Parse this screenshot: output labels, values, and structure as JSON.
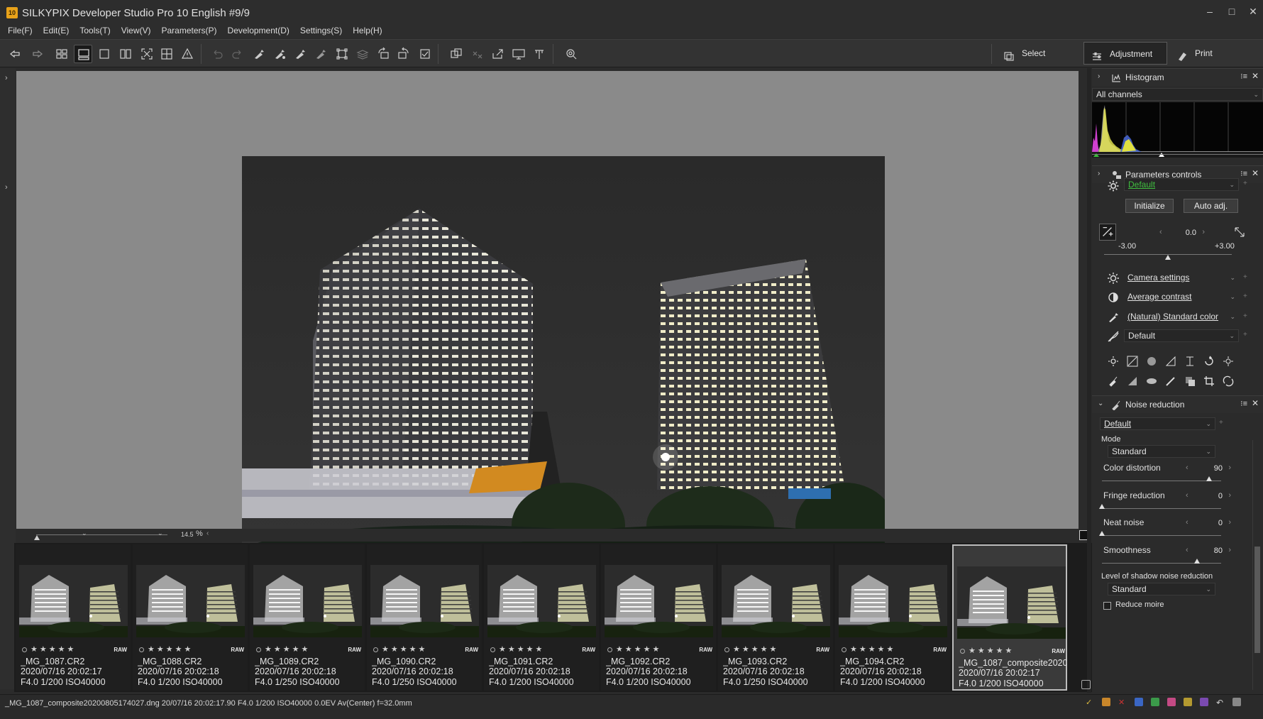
{
  "window": {
    "app_icon_text": "10",
    "title": "SILKYPIX Developer Studio Pro 10 English   #9/9",
    "controls": {
      "minimize": "–",
      "maximize": "□",
      "close": "✕"
    }
  },
  "menubar": {
    "items": [
      "File(F)",
      "Edit(E)",
      "Tools(T)",
      "View(V)",
      "Parameters(P)",
      "Development(D)",
      "Settings(S)",
      "Help(H)"
    ]
  },
  "toolbar": {
    "mode_tabs": [
      {
        "label": "Select",
        "icon": "select-mode-icon"
      },
      {
        "label": "Adjustment",
        "icon": "adjustment-mode-icon",
        "active": true
      },
      {
        "label": "Print",
        "icon": "print-mode-icon"
      }
    ]
  },
  "zoombar": {
    "value": "14.5",
    "unit": "%"
  },
  "thumbnails": [
    {
      "name": "_MG_1087.CR2",
      "datetime": "2020/07/16 20:02:17",
      "exposure": "F4.0 1/200 ISO40000",
      "badge": "RAW",
      "rating": "★★★★★"
    },
    {
      "name": "_MG_1088.CR2",
      "datetime": "2020/07/16 20:02:18",
      "exposure": "F4.0 1/200 ISO40000",
      "badge": "RAW",
      "rating": "★★★★★"
    },
    {
      "name": "_MG_1089.CR2",
      "datetime": "2020/07/16 20:02:18",
      "exposure": "F4.0 1/250 ISO40000",
      "badge": "RAW",
      "rating": "★★★★★"
    },
    {
      "name": "_MG_1090.CR2",
      "datetime": "2020/07/16 20:02:18",
      "exposure": "F4.0 1/250 ISO40000",
      "badge": "RAW",
      "rating": "★★★★★"
    },
    {
      "name": "_MG_1091.CR2",
      "datetime": "2020/07/16 20:02:18",
      "exposure": "F4.0 1/200 ISO40000",
      "badge": "RAW",
      "rating": "★★★★★"
    },
    {
      "name": "_MG_1092.CR2",
      "datetime": "2020/07/16 20:02:18",
      "exposure": "F4.0 1/200 ISO40000",
      "badge": "RAW",
      "rating": "★★★★★"
    },
    {
      "name": "_MG_1093.CR2",
      "datetime": "2020/07/16 20:02:18",
      "exposure": "F4.0 1/250 ISO40000",
      "badge": "RAW",
      "rating": "★★★★★"
    },
    {
      "name": "_MG_1094.CR2",
      "datetime": "2020/07/16 20:02:18",
      "exposure": "F4.0 1/200 ISO40000",
      "badge": "RAW",
      "rating": "★★★★★"
    },
    {
      "name": "_MG_1087_composite2020",
      "datetime": "2020/07/16 20:02:17",
      "exposure": "F4.0 1/200 ISO40000",
      "badge": "RAW",
      "rating": "★★★★★",
      "selected": true
    }
  ],
  "histogram": {
    "title": "Histogram",
    "channel": "All channels"
  },
  "params": {
    "title": "Parameters controls",
    "preset": "Default",
    "initialize": "Initialize",
    "auto_adj": "Auto adj.",
    "exposure": {
      "value": "0.0",
      "min": "-3.00",
      "max": "+3.00",
      "level": 0.5
    },
    "rows": [
      {
        "label": "Camera settings",
        "icon": "white-balance-icon"
      },
      {
        "label": "Average contrast",
        "icon": "contrast-icon"
      },
      {
        "label": "(Natural) Standard color",
        "icon": "color-icon"
      },
      {
        "label": "Default",
        "icon": "tone-curve-icon"
      }
    ]
  },
  "noise": {
    "title": "Noise reduction",
    "preset": "Default",
    "mode_label": "Mode",
    "mode_value": "Standard",
    "params": [
      {
        "label": "Color distortion",
        "value": "90",
        "level": 0.9
      },
      {
        "label": "Fringe reduction",
        "value": "0",
        "level": 0.0
      },
      {
        "label": "Neat noise",
        "value": "0",
        "level": 0.0
      },
      {
        "label": "Smoothness",
        "value": "80",
        "level": 0.8
      }
    ],
    "shadow_label": "Level of shadow noise reduction",
    "shadow_value": "Standard",
    "reduce_moire": "Reduce moire"
  },
  "statusbar": {
    "text": "_MG_1087_composite20200805174027.dng 20/07/16 20:02:17.90 F4.0 1/200 ISO40000  0.0EV Av(Center) f=32.0mm"
  },
  "colors": {
    "bg": "#2b2b2b",
    "preview_bg": "#8a8a8a",
    "accent_green": "#3fbf3f"
  }
}
